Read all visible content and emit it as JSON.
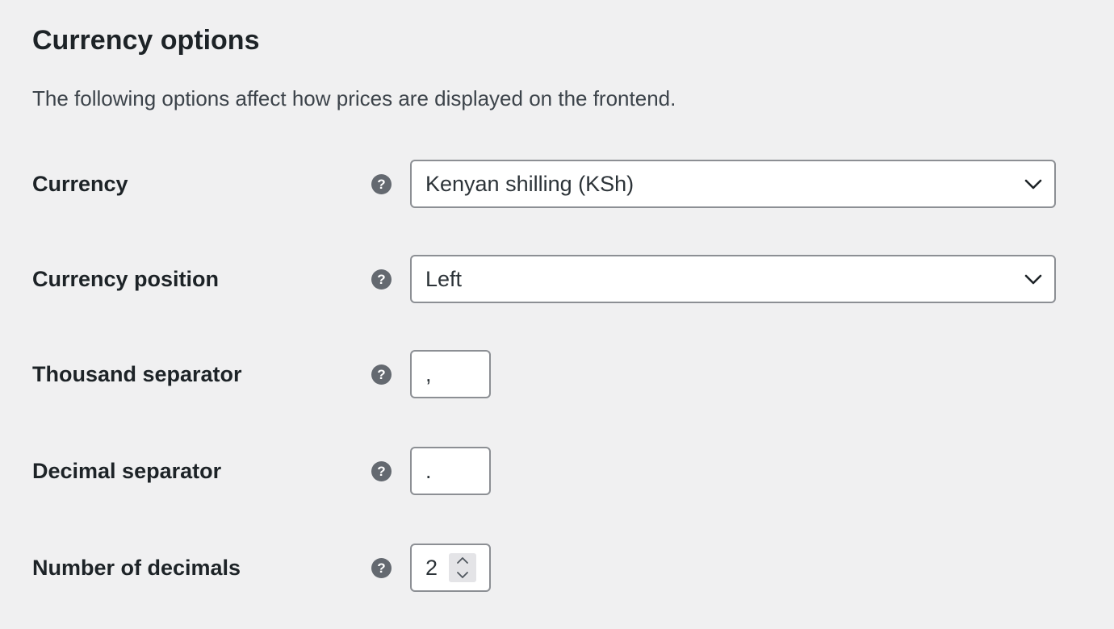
{
  "section": {
    "title": "Currency options",
    "description": "The following options affect how prices are displayed on the frontend."
  },
  "fields": {
    "currency": {
      "label": "Currency",
      "help_icon": "help-circle-icon",
      "help_glyph": "?",
      "value": "Kenyan shilling (KSh)",
      "dropdown_icon": "chevron-down-icon"
    },
    "currency_position": {
      "label": "Currency position",
      "help_icon": "help-circle-icon",
      "help_glyph": "?",
      "value": "Left",
      "dropdown_icon": "chevron-down-icon"
    },
    "thousand_separator": {
      "label": "Thousand separator",
      "help_icon": "help-circle-icon",
      "help_glyph": "?",
      "value": ","
    },
    "decimal_separator": {
      "label": "Decimal separator",
      "help_icon": "help-circle-icon",
      "help_glyph": "?",
      "value": "."
    },
    "number_of_decimals": {
      "label": "Number of decimals",
      "help_icon": "help-circle-icon",
      "help_glyph": "?",
      "value": "2",
      "stepper_icons": [
        "chevron-up-icon",
        "chevron-down-icon"
      ]
    }
  },
  "colors": {
    "background": "#f0f0f1",
    "text": "#1d2327",
    "help_icon_bg": "#646970",
    "input_border": "#8c8f94",
    "input_bg": "#ffffff"
  }
}
